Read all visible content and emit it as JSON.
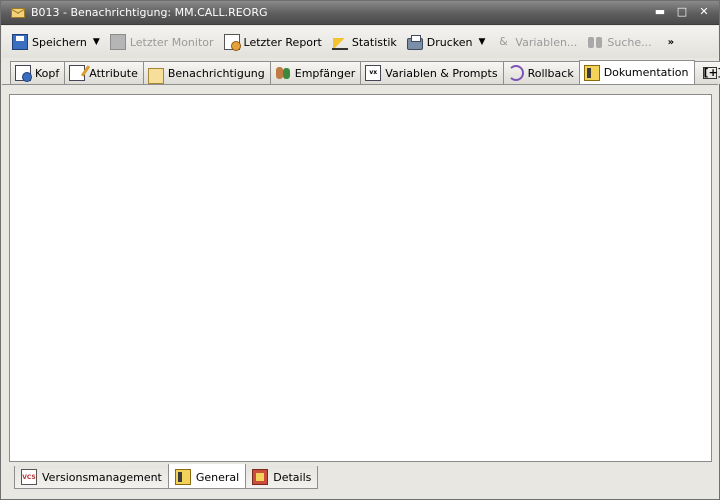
{
  "window": {
    "title": "B013 - Benachrichtigung: MM.CALL.REORG",
    "controls": {
      "minimize": "▬",
      "maximize": "□",
      "close": "✕"
    }
  },
  "toolbar": {
    "save": "Speichern",
    "last_monitor": "Letzter Monitor",
    "last_report": "Letzter Report",
    "statistics": "Statistik",
    "print": "Drucken",
    "variables": "Variablen...",
    "search": "Suche...",
    "more": "»"
  },
  "tabs": [
    {
      "label": "Kopf",
      "icon": "header-doc-icon"
    },
    {
      "label": "Attribute",
      "icon": "attribute-edit-icon"
    },
    {
      "label": "Benachrichtigung",
      "icon": "envelope-icon"
    },
    {
      "label": "Empfänger",
      "icon": "recipients-icon"
    },
    {
      "label": "Variablen & Prompts",
      "icon": "variables-prompts-icon"
    },
    {
      "label": "Rollback",
      "icon": "rollback-icon"
    },
    {
      "label": "Dokumentation",
      "icon": "documentation-icon",
      "active": true
    },
    {
      "label": "[+]",
      "icon": "add-tab-icon"
    }
  ],
  "bottom_tabs": [
    {
      "label": "Versionsmanagement",
      "icon": "version-control-icon"
    },
    {
      "label": "General",
      "icon": "general-doc-icon",
      "active": true
    },
    {
      "label": "Details",
      "icon": "details-icon"
    }
  ]
}
